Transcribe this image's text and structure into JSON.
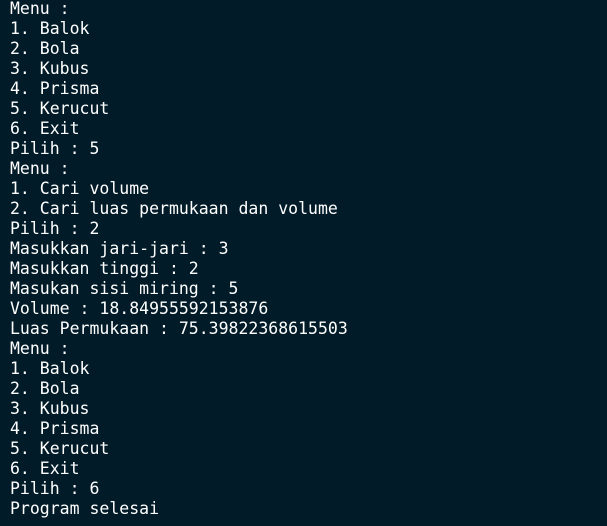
{
  "terminal": {
    "lines": [
      "Menu :",
      "1. Balok",
      "2. Bola",
      "3. Kubus",
      "4. Prisma",
      "5. Kerucut",
      "6. Exit",
      "Pilih : 5",
      "Menu :",
      "1. Cari volume",
      "2. Cari luas permukaan dan volume",
      "Pilih : 2",
      "Masukkan jari-jari : 3",
      "Masukkan tinggi : 2",
      "Masukan sisi miring : 5",
      "Volume : 18.84955592153876",
      "Luas Permukaan : 75.39822368615503",
      "Menu :",
      "1. Balok",
      "2. Bola",
      "3. Kubus",
      "4. Prisma",
      "5. Kerucut",
      "6. Exit",
      "Pilih : 6",
      "Program selesai"
    ],
    "colors": {
      "background": "#011b28",
      "text": "#ffffff"
    }
  }
}
